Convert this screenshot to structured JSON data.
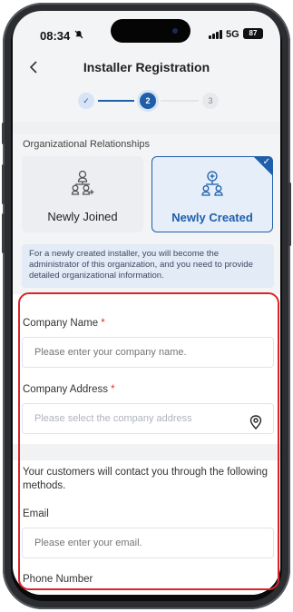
{
  "status_bar": {
    "time": "08:34",
    "network": "5G",
    "battery": "87"
  },
  "header": {
    "title": "Installer Registration"
  },
  "stepper": {
    "step1_label": "✓",
    "step2_label": "2",
    "step3_label": "3"
  },
  "relationship": {
    "section_label": "Organizational Relationships",
    "options": [
      {
        "label": "Newly Joined",
        "selected": false
      },
      {
        "label": "Newly Created",
        "selected": true
      }
    ],
    "info": "For a newly created installer, you will become the administrator of this organization, and you need to provide detailed organizational information."
  },
  "form": {
    "company_name_label": "Company Name",
    "company_name_placeholder": "Please enter your company name.",
    "company_address_label": "Company Address",
    "company_address_placeholder": "Please select the company address",
    "required_mark": "*",
    "contact_intro": "Your customers will contact you through the following methods.",
    "email_label": "Email",
    "email_placeholder": "Please enter your email.",
    "phone_label": "Phone Number"
  },
  "colors": {
    "accent": "#1f5faa",
    "required": "#e03131",
    "highlight": "#d7262b"
  },
  "icons": {
    "back": "chevron-left-icon",
    "joined": "org-join-icon",
    "created": "org-create-icon",
    "location": "location-pin-icon",
    "mute": "bell-slash-icon"
  }
}
